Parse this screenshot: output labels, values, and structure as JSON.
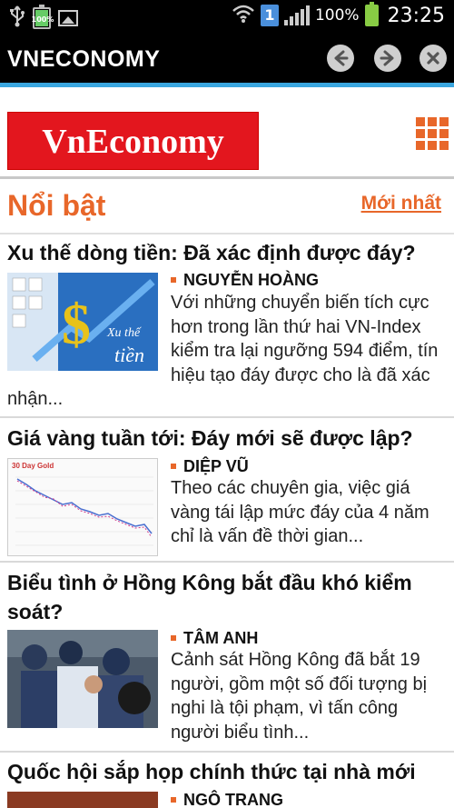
{
  "status_bar": {
    "battery_small_pct": "100%",
    "sim_badge": "1",
    "battery_pct": "100%",
    "time": "23:25",
    "icons": [
      "usb-icon",
      "battery-icon",
      "gallery-icon",
      "wifi-icon",
      "sim-icon",
      "signal-icon",
      "battery-icon"
    ]
  },
  "app_bar": {
    "title": "VNECONOMY",
    "back_icon": "arrow-left-icon",
    "forward_icon": "arrow-right-icon",
    "close_icon": "close-icon",
    "accent": "#3aa6df"
  },
  "header": {
    "logo_text": "VnEconomy",
    "logo_color": "#e3161e",
    "menu_icon": "grid-icon"
  },
  "section": {
    "title": "Nổi bật",
    "link": "Mới nhất",
    "accent": "#e8672a"
  },
  "articles": [
    {
      "title": "Xu thế dòng tiền: Đã xác định được đáy?",
      "author": "NGUYỄN HOÀNG",
      "summary": "Với những chuyển biến tích cực hơn trong lần thứ hai VN-Index kiểm tra lại ngưỡng 594 điểm, tín hiệu tạo đáy được cho là đã xác nhận...",
      "thumb_text": "Xu thế tiền"
    },
    {
      "title": "Giá vàng tuần tới: Đáy mới sẽ được lập?",
      "author": "DIỆP VŨ",
      "summary": "Theo các chuyên gia, việc giá vàng tái lập mức đáy của 4 năm chỉ là vấn đề thời gian...",
      "thumb_text": "30 Day Gold"
    },
    {
      "title": "Biểu tình ở Hồng Kông bắt đầu khó kiểm soát?",
      "author": "TÂM ANH",
      "summary": "Cảnh sát Hồng Kông đã bắt 19 người, gồm một số đối tượng bị nghi là tội phạm, vì tấn công người biểu tình...",
      "thumb_text": ""
    },
    {
      "title": "Quốc hội sắp họp chính thức tại nhà mới",
      "author": "NGÔ TRANG",
      "summary": "",
      "thumb_text": ""
    }
  ]
}
